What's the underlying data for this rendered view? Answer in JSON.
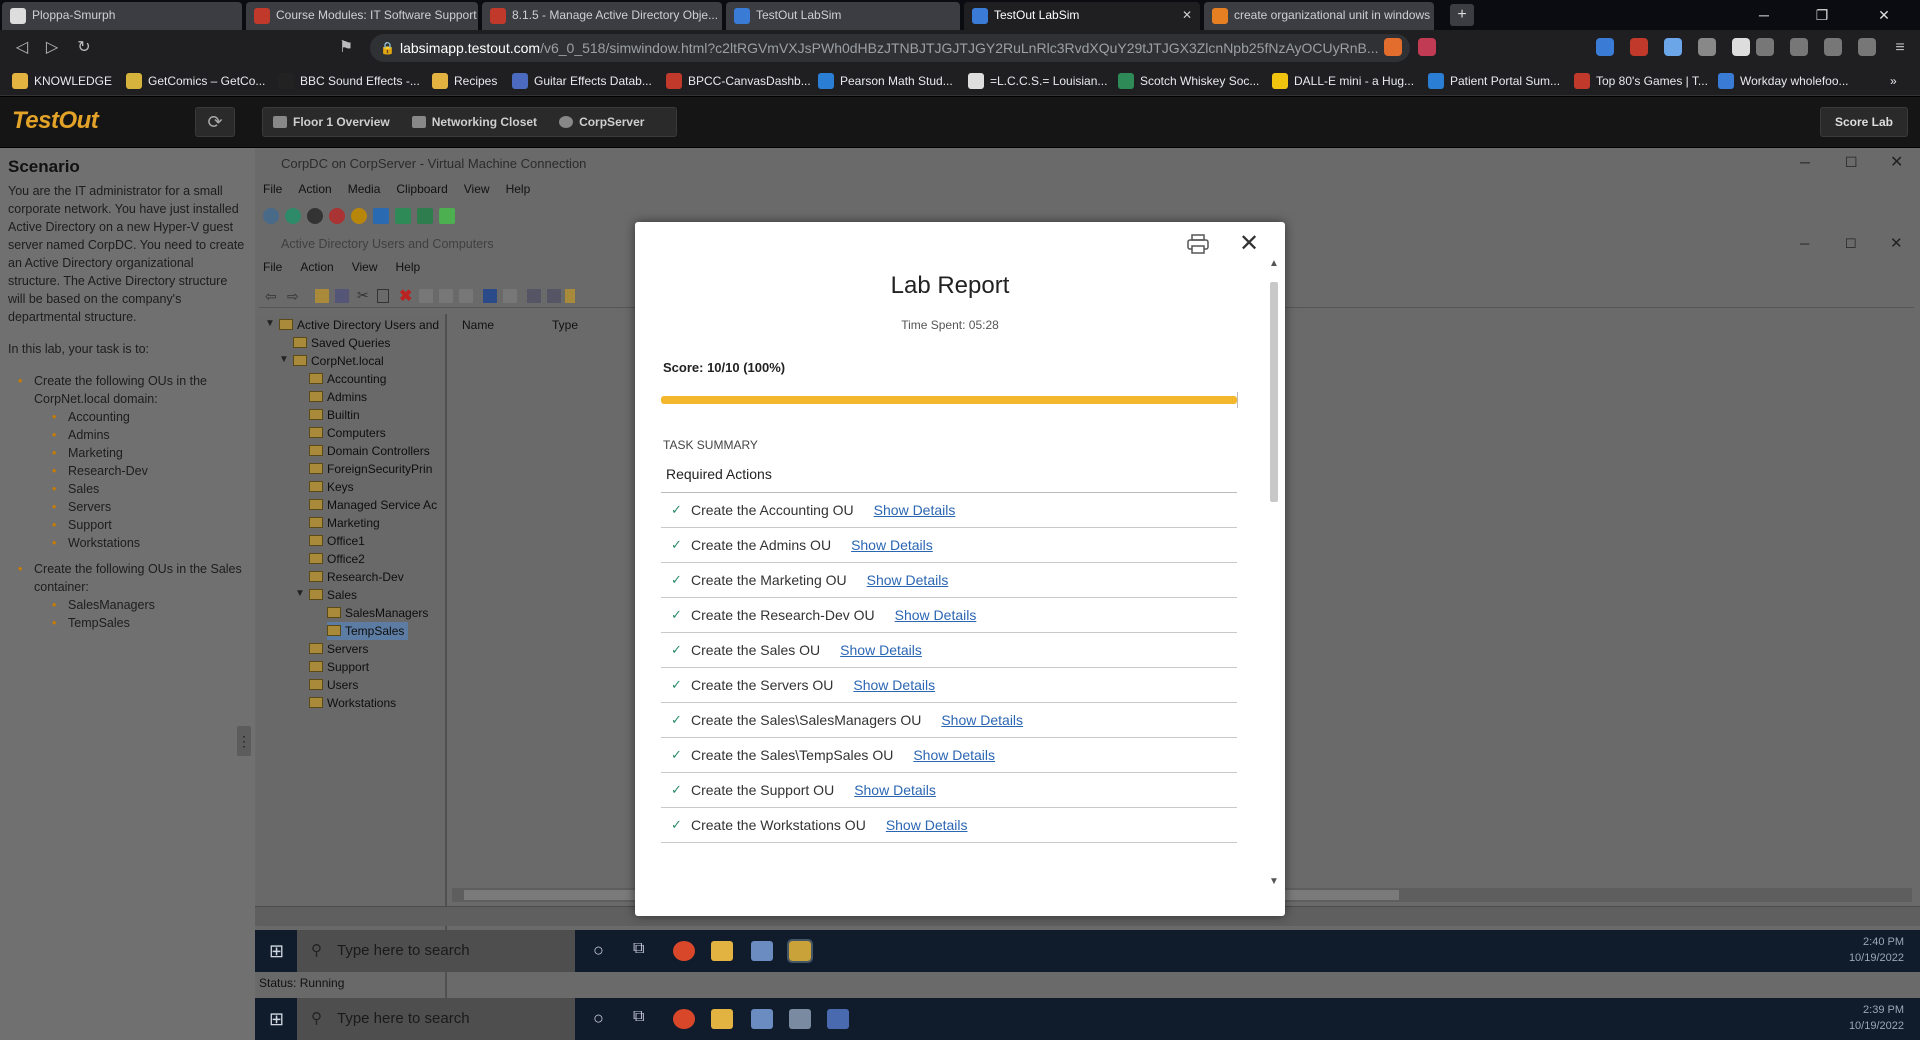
{
  "browser": {
    "tabs": [
      {
        "title": "Ploppa-Smurph",
        "color": "#ffffff"
      },
      {
        "title": "Course Modules: IT Software Support",
        "color": "#c0392b"
      },
      {
        "title": "8.1.5 - Manage Active Directory Obje...",
        "color": "#c0392b"
      },
      {
        "title": "TestOut LabSim",
        "color": "#3a7bd5"
      },
      {
        "title": "TestOut LabSim",
        "color": "#3a7bd5"
      },
      {
        "title": "create organizational unit in windows se...",
        "color": "#e67e22"
      }
    ],
    "url_host": "labsimapp.testout.com",
    "url_rest": "/v6_0_518/simwindow.html?c2ltRGVmVXJsPWh0dHBzJTNBJTJGJTJGY2RuLnRlc3RvdXQuY29tJTJGX3ZlcnNpb25fNzAyOCUyRnB...",
    "bookmarks": [
      "KNOWLEDGE",
      "GetComics – GetCo...",
      "BBC Sound Effects -...",
      "Recipes",
      "Guitar Effects Datab...",
      "BPCC-CanvasDashb...",
      "Pearson Math Stud...",
      "=L.C.C.S.= Louisian...",
      "Scotch Whiskey Soc...",
      "DALL-E mini - a Hug...",
      "Patient Portal Sum...",
      "Top 80's Games | T...",
      "Workday wholefoo..."
    ]
  },
  "app": {
    "logo": "TestOut",
    "crumbs": [
      "Floor 1 Overview",
      "Networking Closet",
      "CorpServer"
    ],
    "score_lab": "Score Lab"
  },
  "scenario": {
    "title": "Scenario",
    "intro": "You are the IT administrator for a small corporate network. You have just installed Active Directory on a new Hyper-V guest server named CorpDC. You need to create an Active Directory organizational structure. The Active Directory structure will be based on the company's departmental structure.",
    "task_intro": "In this lab, your task is to:",
    "task1": "Create the following OUs in the CorpNet.local domain:",
    "task1_items": [
      "Accounting",
      "Admins",
      "Marketing",
      "Research-Dev",
      "Sales",
      "Servers",
      "Support",
      "Workstations"
    ],
    "task2": "Create the following OUs in the Sales container:",
    "task2_items": [
      "SalesManagers",
      "TempSales"
    ]
  },
  "vm": {
    "title": "CorpDC on CorpServer - Virtual Machine Connection",
    "menu": [
      "File",
      "Action",
      "Media",
      "Clipboard",
      "View",
      "Help"
    ],
    "ad_title": "Active Directory Users and Computers",
    "ad_menu": [
      "File",
      "Action",
      "View",
      "Help"
    ],
    "tree": {
      "root": "Active Directory Users and",
      "saved": "Saved Queries",
      "domain": "CorpNet.local",
      "ous": [
        "Accounting",
        "Admins",
        "Builtin",
        "Computers",
        "Domain Controllers",
        "ForeignSecurityPrin",
        "Keys",
        "Managed Service Ac",
        "Marketing",
        "Office1",
        "Office2",
        "Research-Dev"
      ],
      "sales": "Sales",
      "sales_children": [
        "SalesManagers",
        "TempSales"
      ],
      "after": [
        "Servers",
        "Support",
        "Users",
        "Workstations"
      ]
    },
    "list_headers": [
      "Name",
      "Type"
    ],
    "inner_taskbar": {
      "search": "Type here to search",
      "time": "2:40 PM",
      "date": "10/19/2022"
    },
    "status": "Status: Running",
    "outer_taskbar": {
      "search": "Type here to search",
      "time": "2:39 PM",
      "date": "10/19/2022"
    }
  },
  "report": {
    "title": "Lab Report",
    "time_spent": "Time Spent: 05:28",
    "score": "Score: 10/10 (100%)",
    "progress_pct": 100,
    "task_summary": "TASK SUMMARY",
    "required": "Required Actions",
    "link_label": "Show Details",
    "tasks": [
      "Create the Accounting OU",
      "Create the Admins OU",
      "Create the Marketing OU",
      "Create the Research-Dev OU",
      "Create the Sales OU",
      "Create the Servers OU",
      "Create the Sales\\SalesManagers OU",
      "Create the Sales\\TempSales OU",
      "Create the Support OU",
      "Create the Workstations OU"
    ]
  }
}
